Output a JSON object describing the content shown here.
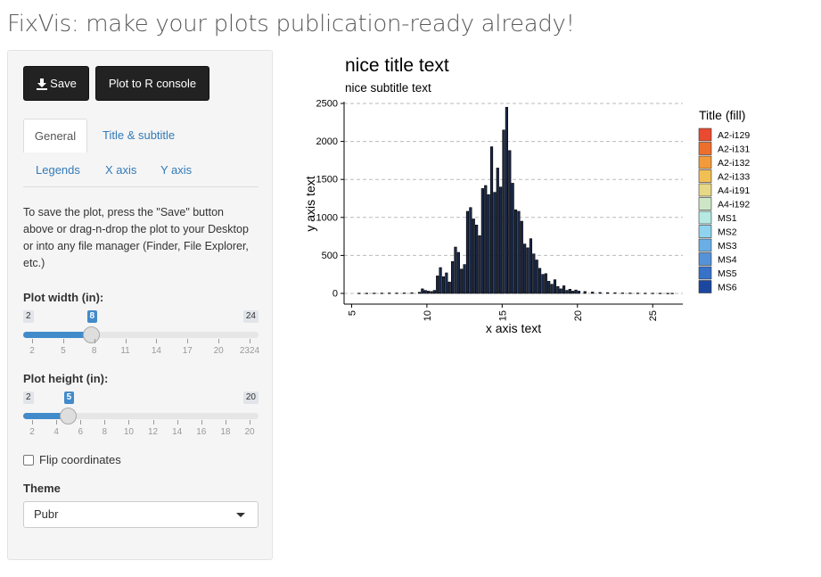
{
  "app_title": "FixVis: make your plots publication-ready already!",
  "toolbar": {
    "save_label": "Save",
    "plot_console_label": "Plot to R console",
    "save_icon": "download-icon"
  },
  "tabs": [
    {
      "label": "General",
      "active": true
    },
    {
      "label": "Title & subtitle",
      "active": false
    },
    {
      "label": "Legends",
      "active": false
    },
    {
      "label": "X axis",
      "active": false
    },
    {
      "label": "Y axis",
      "active": false
    }
  ],
  "help_text": "To save the plot, press the \"Save\" button above or drag-n-drop the plot to your Desktop or into any file manager (Finder, File Explorer, etc.)",
  "plot_width": {
    "label": "Plot width (in):",
    "min": 2,
    "max": 24,
    "value": 8,
    "min_label": "2",
    "max_label": "24",
    "value_label": "8",
    "grid": [
      "2",
      "5",
      "8",
      "11",
      "14",
      "17",
      "20",
      "2324"
    ]
  },
  "plot_height": {
    "label": "Plot height (in):",
    "min": 2,
    "max": 20,
    "value": 5,
    "min_label": "2",
    "max_label": "20",
    "value_label": "5",
    "grid": [
      "2",
      "4",
      "6",
      "8",
      "10",
      "12",
      "14",
      "16",
      "18",
      "20"
    ]
  },
  "flip_coordinates": {
    "label": "Flip coordinates",
    "checked": false
  },
  "theme": {
    "label": "Theme",
    "selected": "Pubr"
  },
  "colors": {
    "accent": "#428bca",
    "link": "#337ab7",
    "button_bg": "#222222"
  },
  "chart_data": {
    "type": "bar",
    "title": "nice title text",
    "subtitle": "nice subtitle text",
    "xlabel": "x axis text",
    "ylabel": "y axis text",
    "xlim": [
      4.5,
      27
    ],
    "ylim": [
      0,
      2500
    ],
    "x_ticks": [
      "5",
      "10",
      "15",
      "20",
      "25"
    ],
    "y_ticks": [
      "0",
      "500",
      "1000",
      "1500",
      "2000",
      "2500"
    ],
    "grid": "horizontal dashed",
    "legend": {
      "title": "Title (fill)",
      "placement": "right",
      "entries": [
        {
          "name": "A2-i129",
          "color": "#e84b30"
        },
        {
          "name": "A2-i131",
          "color": "#ed6f2c"
        },
        {
          "name": "A2-i132",
          "color": "#f39b3a"
        },
        {
          "name": "A2-i133",
          "color": "#f2bf55"
        },
        {
          "name": "A4-i191",
          "color": "#e6d887"
        },
        {
          "name": "A4-i192",
          "color": "#cde7c6"
        },
        {
          "name": "MS1",
          "color": "#b5e9e2"
        },
        {
          "name": "MS2",
          "color": "#8fd3ee"
        },
        {
          "name": "MS3",
          "color": "#6aaee6"
        },
        {
          "name": "MS4",
          "color": "#5592d8"
        },
        {
          "name": "MS5",
          "color": "#3772c8"
        },
        {
          "name": "MS6",
          "color": "#1b47a0"
        }
      ]
    },
    "bars": [
      [
        5.5,
        3
      ],
      [
        6,
        3
      ],
      [
        6.5,
        4
      ],
      [
        7,
        4
      ],
      [
        7.5,
        5
      ],
      [
        8,
        5
      ],
      [
        8.5,
        6
      ],
      [
        9,
        8
      ],
      [
        9.5,
        15
      ],
      [
        9.7,
        60
      ],
      [
        9.9,
        40
      ],
      [
        10.1,
        30
      ],
      [
        10.3,
        25
      ],
      [
        10.5,
        40
      ],
      [
        10.7,
        230
      ],
      [
        10.9,
        340
      ],
      [
        11.1,
        220
      ],
      [
        11.3,
        270
      ],
      [
        11.5,
        150
      ],
      [
        11.7,
        420
      ],
      [
        11.9,
        610
      ],
      [
        12.1,
        540
      ],
      [
        12.3,
        320
      ],
      [
        12.5,
        380
      ],
      [
        12.7,
        1080
      ],
      [
        12.9,
        1130
      ],
      [
        13.1,
        980
      ],
      [
        13.3,
        900
      ],
      [
        13.5,
        760
      ],
      [
        13.7,
        1380
      ],
      [
        13.9,
        1420
      ],
      [
        14.1,
        1300
      ],
      [
        14.3,
        1930
      ],
      [
        14.5,
        1330
      ],
      [
        14.7,
        1650
      ],
      [
        14.9,
        1400
      ],
      [
        15.1,
        2150
      ],
      [
        15.3,
        2450
      ],
      [
        15.5,
        1880
      ],
      [
        15.7,
        1450
      ],
      [
        15.9,
        1100
      ],
      [
        16.1,
        1080
      ],
      [
        16.3,
        950
      ],
      [
        16.5,
        650
      ],
      [
        16.7,
        600
      ],
      [
        16.9,
        720
      ],
      [
        17.1,
        520
      ],
      [
        17.3,
        440
      ],
      [
        17.5,
        330
      ],
      [
        17.7,
        250
      ],
      [
        17.9,
        260
      ],
      [
        18.1,
        160
      ],
      [
        18.3,
        120
      ],
      [
        18.5,
        180
      ],
      [
        18.7,
        90
      ],
      [
        18.9,
        60
      ],
      [
        19.1,
        100
      ],
      [
        19.3,
        40
      ],
      [
        19.5,
        55
      ],
      [
        19.7,
        30
      ],
      [
        19.9,
        45
      ],
      [
        20.1,
        30
      ],
      [
        20.5,
        25
      ],
      [
        21,
        18
      ],
      [
        21.5,
        12
      ],
      [
        22,
        10
      ],
      [
        22.5,
        8
      ],
      [
        23,
        6
      ],
      [
        23.5,
        5
      ],
      [
        24,
        4
      ],
      [
        24.5,
        3
      ],
      [
        25,
        3
      ],
      [
        25.5,
        3
      ],
      [
        26,
        2
      ],
      [
        26.3,
        2
      ]
    ]
  }
}
